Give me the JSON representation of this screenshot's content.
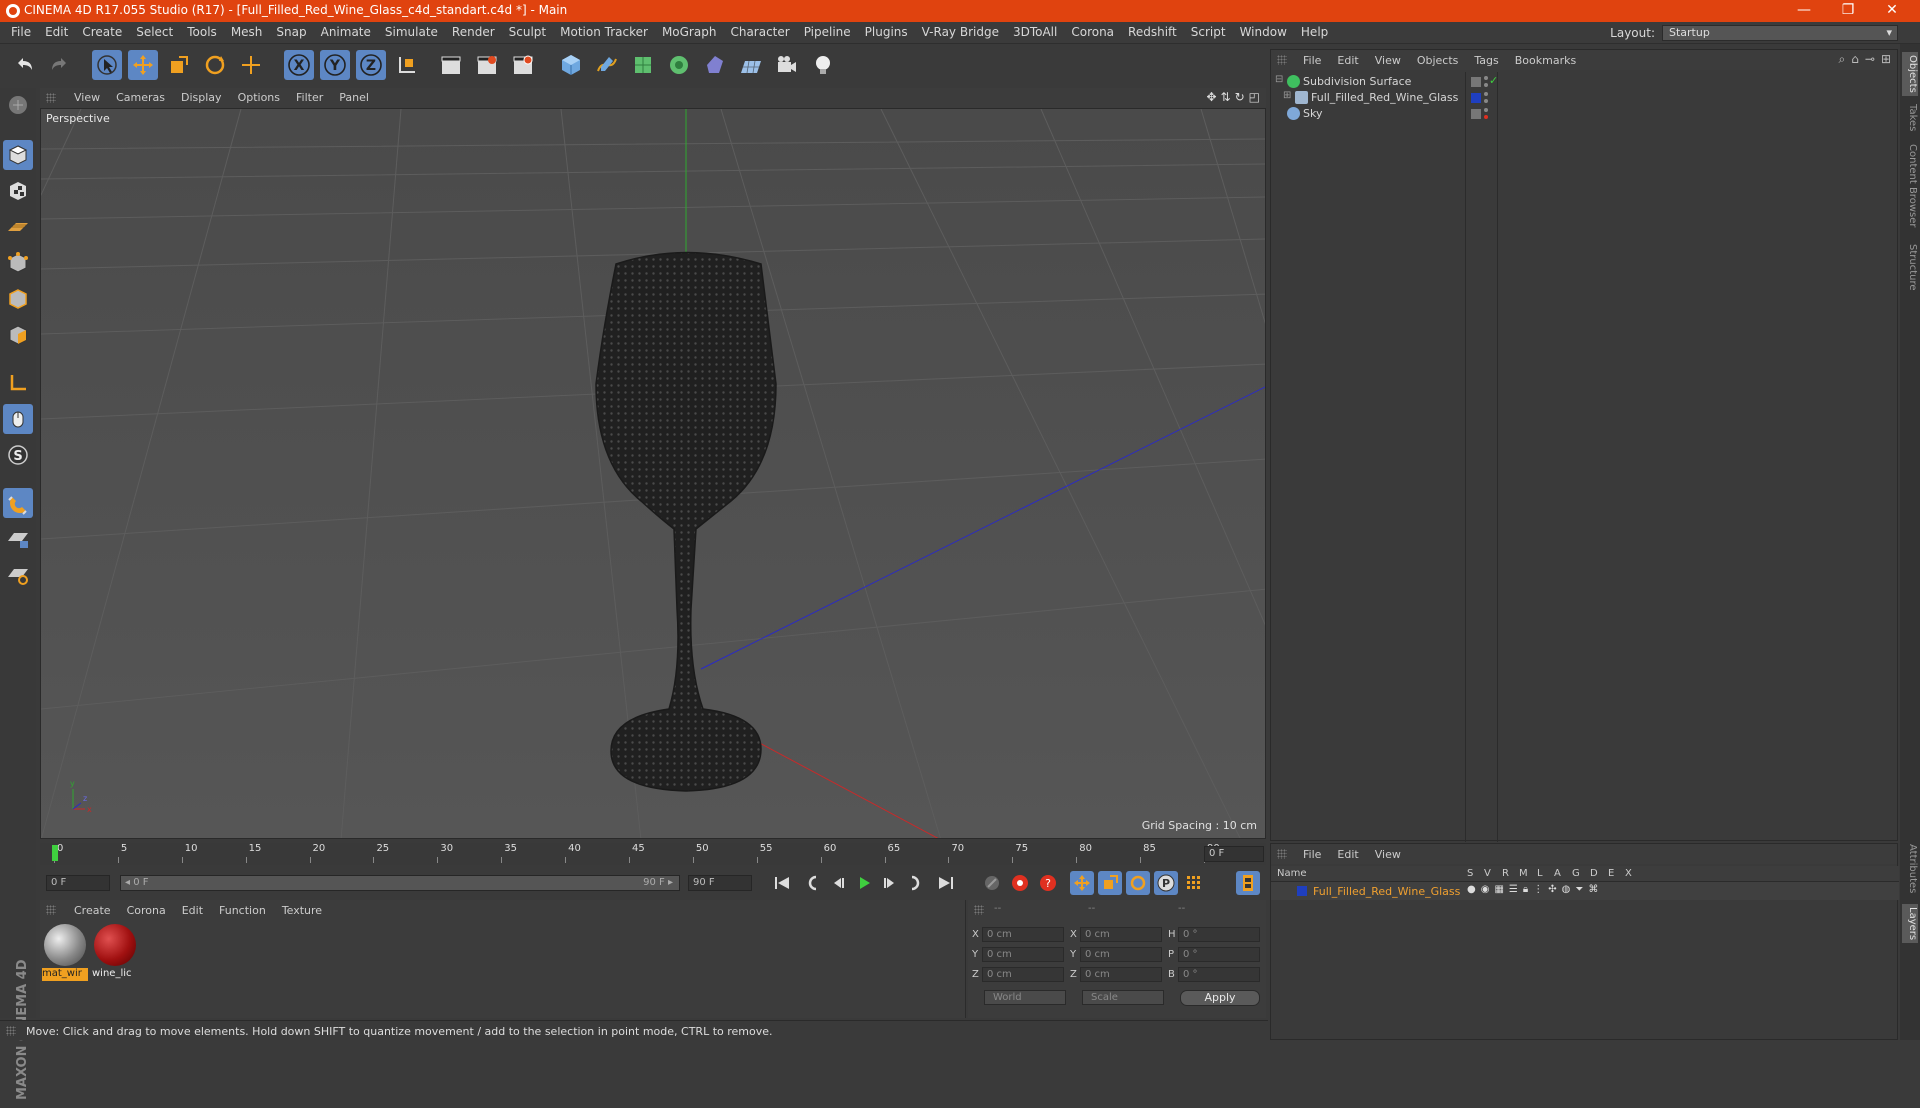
{
  "title_bar": {
    "title": "CINEMA 4D R17.055 Studio (R17) - [Full_Filled_Red_Wine_Glass_c4d_standart.c4d *] - Main",
    "minimize": "—",
    "maximize": "❐",
    "close": "✕"
  },
  "menu": {
    "items": [
      "File",
      "Edit",
      "Create",
      "Select",
      "Tools",
      "Mesh",
      "Snap",
      "Animate",
      "Simulate",
      "Render",
      "Sculpt",
      "Motion Tracker",
      "MoGraph",
      "Character",
      "Pipeline",
      "Plugins",
      "V-Ray Bridge",
      "3DToAll",
      "Corona",
      "Redshift",
      "Script",
      "Window",
      "Help"
    ],
    "layout_label": "Layout:",
    "layout_value": "Startup"
  },
  "viewport": {
    "menu": [
      "View",
      "Cameras",
      "Display",
      "Options",
      "Filter",
      "Panel"
    ],
    "label": "Perspective",
    "grid_spacing": "Grid Spacing : 10 cm"
  },
  "timeline": {
    "ticks": [
      "0",
      "5",
      "10",
      "15",
      "20",
      "25",
      "30",
      "35",
      "40",
      "45",
      "50",
      "55",
      "60",
      "65",
      "70",
      "75",
      "80",
      "85",
      "90"
    ],
    "current_frame_field": "0 F",
    "start_field": "0 F",
    "range_start": "◂ 0 F",
    "range_end": "90 F ▸",
    "end_field": "90 F"
  },
  "material_manager": {
    "menu": [
      "Create",
      "Corona",
      "Edit",
      "Function",
      "Texture"
    ],
    "materials": [
      {
        "label": "mat_wir",
        "color": "#b0b0b0"
      },
      {
        "label": "wine_lic",
        "color": "#b01818"
      }
    ]
  },
  "coordinates": {
    "header": [
      "--",
      "--",
      "--"
    ],
    "rows": [
      {
        "a1": "X",
        "v1": "0 cm",
        "a2": "X",
        "v2": "0 cm",
        "a3": "H",
        "v3": "0 °"
      },
      {
        "a1": "Y",
        "v1": "0 cm",
        "a2": "Y",
        "v2": "0 cm",
        "a3": "P",
        "v3": "0 °"
      },
      {
        "a1": "Z",
        "v1": "0 cm",
        "a2": "Z",
        "v2": "0 cm",
        "a3": "B",
        "v3": "0 °"
      }
    ],
    "space": "World",
    "mode": "Scale",
    "apply": "Apply"
  },
  "status_bar": {
    "text": "Move: Click and drag to move elements. Hold down SHIFT to quantize movement / add to the selection in point mode, CTRL to remove."
  },
  "object_manager": {
    "menu": [
      "File",
      "Edit",
      "View",
      "Objects",
      "Tags",
      "Bookmarks"
    ],
    "objects": [
      {
        "name": "Subdivision Surface",
        "icon_color": "#3fbf5f"
      },
      {
        "name": "Full_Filled_Red_Wine_Glass",
        "icon_color": "#9fb6d0"
      },
      {
        "name": "Sky",
        "icon_color": "#7fa8d8"
      }
    ]
  },
  "layer_manager": {
    "menu": [
      "File",
      "Edit",
      "View"
    ],
    "columns": [
      "Name",
      "S",
      "V",
      "R",
      "M",
      "L",
      "A",
      "G",
      "D",
      "E",
      "X"
    ],
    "layer_name": "Full_Filled_Red_Wine_Glass",
    "layer_color": "#1f3fbf"
  },
  "right_tabs": [
    "Objects",
    "Takes",
    "Content Browser",
    "Structure",
    "Attributes",
    "Layers"
  ],
  "colors": {
    "title_bar": "#e0430f",
    "accent_blue": "#5d87c4",
    "timeline_marker": "#3fcf3f"
  }
}
